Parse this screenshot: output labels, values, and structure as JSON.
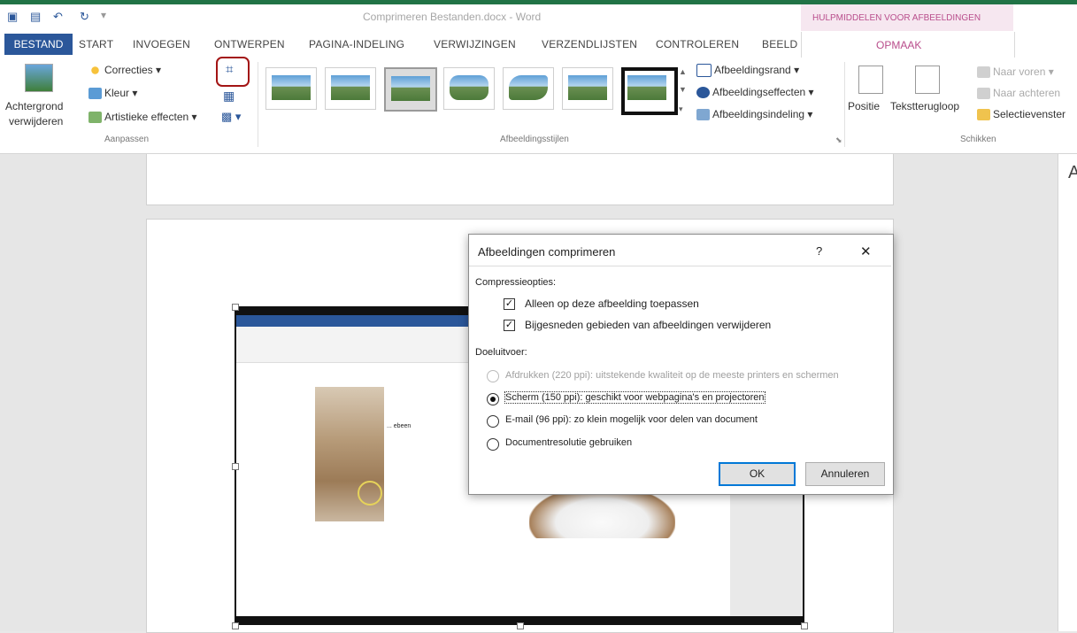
{
  "window": {
    "title": "Comprimeren Bestanden.docx - Word",
    "context_tab_header": "HULPMIDDELEN VOOR AFBEELDINGEN"
  },
  "tabs": [
    "BESTAND",
    "START",
    "INVOEGEN",
    "ONTWERPEN",
    "PAGINA-INDELING",
    "VERWIJZINGEN",
    "VERZENDLIJSTEN",
    "CONTROLEREN",
    "BEELD"
  ],
  "context_tab": "OPMAAK",
  "ribbon": {
    "aanpassen": {
      "remove_bg_line1": "Achtergrond",
      "remove_bg_line2": "verwijderen",
      "corrections": "Correcties",
      "color": "Kleur",
      "artistic": "Artistieke effecten",
      "label": "Aanpassen"
    },
    "stijlen": {
      "border": "Afbeeldingsrand",
      "effects": "Afbeeldingseffecten",
      "layout": "Afbeeldingsindeling",
      "label": "Afbeeldingsstijlen"
    },
    "schikken": {
      "position": "Positie",
      "wrap": "Tekstterugloop",
      "forward": "Naar voren",
      "backward": "Naar achteren",
      "selection": "Selectievenster",
      "label": "Schikken"
    }
  },
  "right_pane_letter": "A",
  "dialog": {
    "title": "Afbeeldingen comprimeren",
    "help": "?",
    "close": "✕",
    "compress_header": "Compressieopties:",
    "cb1": "Alleen op deze afbeelding toepassen",
    "cb2": "Bijgesneden gebieden van afbeeldingen verwijderen",
    "target_header": "Doeluitvoer:",
    "opt_print": "Afdrukken (220 ppi): uitstekende kwaliteit op de meeste printers en schermen",
    "opt_screen": "Scherm (150 ppi): geschikt voor webpagina's en projectoren",
    "opt_email": "E-mail (96 ppi): zo klein mogelijk voor delen van document",
    "opt_docres": "Documentresolutie gebruiken",
    "selected_option": "Scherm (150 ppi)",
    "ok": "OK",
    "cancel": "Annuleren"
  },
  "embedded_image_text": "... ebeen"
}
